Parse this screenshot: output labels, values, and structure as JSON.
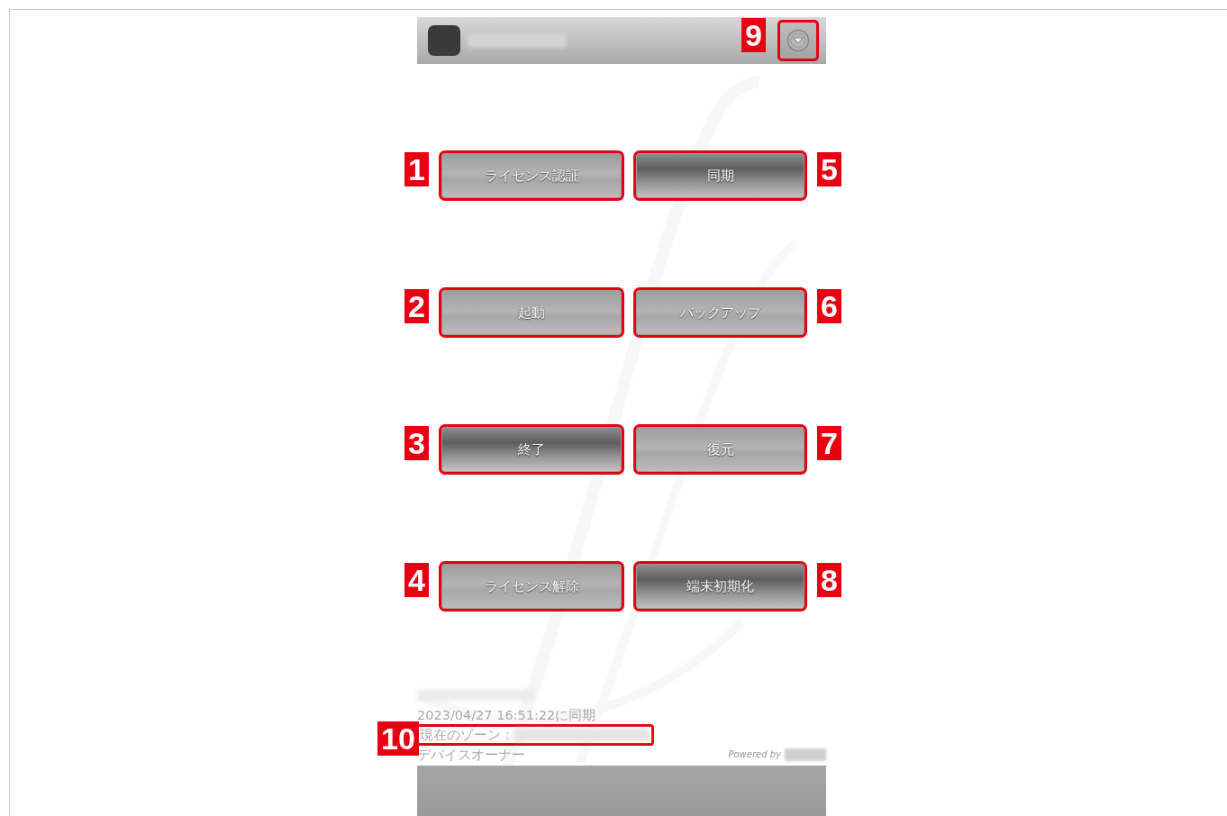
{
  "header": {
    "menu_button": {
      "callout": "9"
    }
  },
  "buttons": [
    {
      "label": "ライセンス認証",
      "highlighted": false,
      "callout": "1"
    },
    {
      "label": "同期",
      "highlighted": true,
      "callout": "5"
    },
    {
      "label": "起動",
      "highlighted": false,
      "callout": "2"
    },
    {
      "label": "バックアップ",
      "highlighted": false,
      "callout": "6"
    },
    {
      "label": "終了",
      "highlighted": true,
      "callout": "3"
    },
    {
      "label": "復元",
      "highlighted": false,
      "callout": "7"
    },
    {
      "label": "ライセンス解除",
      "highlighted": false,
      "callout": "4"
    },
    {
      "label": "端末初期化",
      "highlighted": true,
      "callout": "8"
    }
  ],
  "footer": {
    "sync_status": "2023/04/27 16:51:22に同期",
    "zone_label": "現在のゾーン：",
    "zone_callout": "10",
    "owner": "デバイスオーナー",
    "powered_by": "Powered by"
  }
}
